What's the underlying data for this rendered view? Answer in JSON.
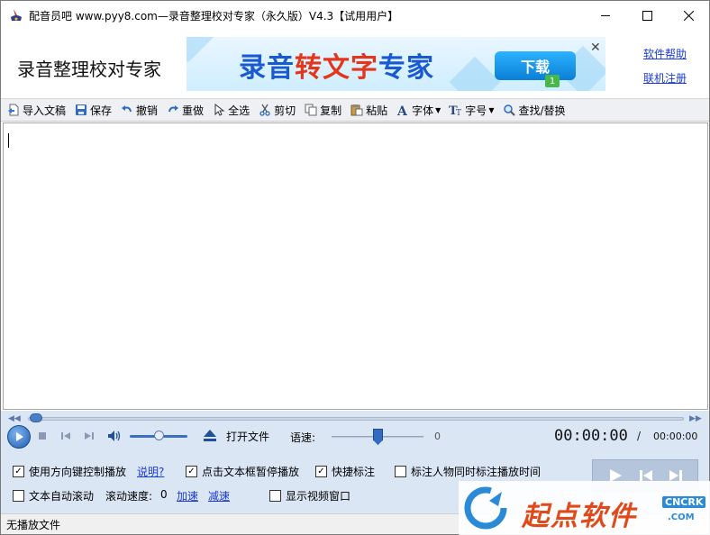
{
  "window": {
    "title": "配音员吧 www.pyy8.com—录音整理校对专家（永久版）V4.3【试用用户】",
    "controls": [
      "minimize",
      "maximize",
      "close"
    ]
  },
  "header": {
    "app_name": "录音整理校对专家",
    "banner_text_part1": "录音",
    "banner_text_part2": "转文字",
    "banner_text_part3": "专家",
    "banner_download": "下载",
    "banner_badge": "1",
    "banner_close": "✕",
    "help_link": "软件帮助",
    "register_link": "联机注册"
  },
  "toolbar": {
    "import_label": "导入文稿",
    "save_label": "保存",
    "undo_label": "撤销",
    "redo_label": "重做",
    "select_all_label": "全选",
    "cut_label": "剪切",
    "copy_label": "复制",
    "paste_label": "粘贴",
    "font_label": "字体",
    "font_size_label": "字号",
    "find_replace_label": "查找/替换"
  },
  "editor": {
    "content": ""
  },
  "player": {
    "open_file_label": "打开文件",
    "speed_label": "语速:",
    "speed_value": "0",
    "time_current": "00:00:00",
    "time_separator": "/",
    "time_total": "00:00:00",
    "seek_progress": 0,
    "volume_level": 0.55,
    "speed_level": 0.5
  },
  "options": {
    "arrow_keys_label": "使用方向键控制播放",
    "arrow_keys_checked": true,
    "explain_link": "说明?",
    "click_pause_label": "点击文本框暂停播放",
    "click_pause_checked": true,
    "quick_mark_label": "快捷标注",
    "quick_mark_checked": true,
    "mark_time_label": "标注人物同时标注播放时间",
    "mark_time_checked": false,
    "auto_scroll_label": "文本自动滚动",
    "auto_scroll_checked": false,
    "scroll_speed_label": "滚动速度:",
    "scroll_speed_value": "0",
    "speed_up_link": "加速",
    "slow_down_link": "减速",
    "show_video_label": "显示视频窗口",
    "show_video_checked": false
  },
  "status": {
    "text": "无播放文件"
  },
  "watermark": {
    "text": "起点软件",
    "badge": "CNCRK",
    "domain": ".COM"
  },
  "colors": {
    "accent": "#1a3bd6",
    "player_bg": "#dbe6f5",
    "toolbar_bg": "#eef0f4"
  }
}
